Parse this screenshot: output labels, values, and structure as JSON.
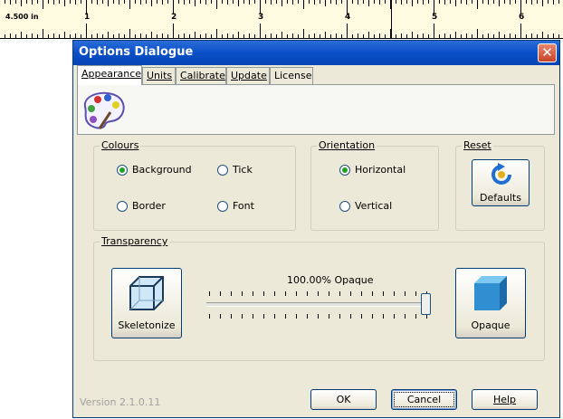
{
  "ruler": {
    "reading": "4.500 in",
    "numbers": [
      "1",
      "2",
      "3",
      "4",
      "5",
      "6"
    ]
  },
  "dialog": {
    "title": "Options Dialogue",
    "close_glyph": "✕"
  },
  "tabs": [
    {
      "label": "Appearance",
      "selected": true
    },
    {
      "label": "Units",
      "selected": false
    },
    {
      "label": "Calibrate",
      "selected": false
    },
    {
      "label": "Update",
      "selected": false
    },
    {
      "label": "License",
      "selected": false
    }
  ],
  "colours": {
    "label": "Colours",
    "options": [
      {
        "label": "Background",
        "checked": true
      },
      {
        "label": "Tick",
        "checked": false
      },
      {
        "label": "Border",
        "checked": false
      },
      {
        "label": "Font",
        "checked": false
      }
    ]
  },
  "orientation": {
    "label": "Orientation",
    "options": [
      {
        "label": "Horizontal",
        "checked": true
      },
      {
        "label": "Vertical",
        "checked": false
      }
    ]
  },
  "reset": {
    "label": "Reset",
    "defaults_label": "Defaults"
  },
  "transparency": {
    "label": "Transparency",
    "skeletonize_label": "Skeletonize",
    "opaque_label": "Opaque",
    "value_text": "100.00% Opaque",
    "slider_value": 1.0
  },
  "footer": {
    "version": "Version 2.1.0.11",
    "ok_label": "OK",
    "cancel_label": "Cancel",
    "help_label": "Help"
  },
  "colors": {
    "titlebar": "#0a4fc8",
    "dialog_bg": "#ece9d8",
    "ruler_bg": "#fffbe0",
    "cube_blue": "#2f8fd0"
  }
}
